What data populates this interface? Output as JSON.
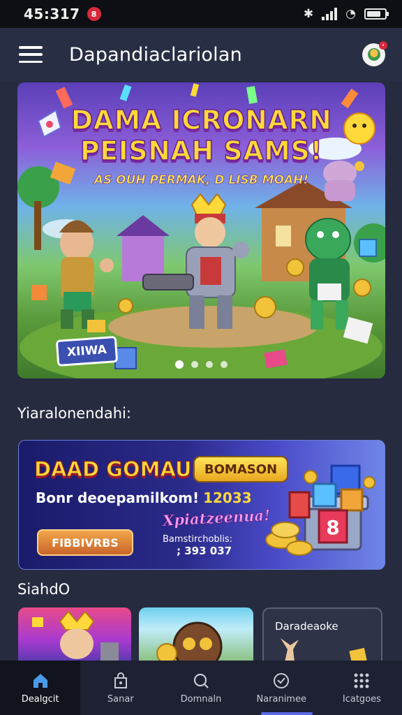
{
  "status_bar": {
    "time": "45:317",
    "notification_count": "8"
  },
  "app_bar": {
    "title": "Dapandiaclariolan"
  },
  "hero": {
    "title_line1": "DAMA ICRONARN",
    "title_line2": "PEISNAH SAMS!",
    "subtitle": "AS OUH PERMAK, D LISB MOAH!",
    "tag": "XIIWA",
    "slide_count": 4,
    "active_slide": 0
  },
  "sections": {
    "featured_title": "Yiaralonendahi:",
    "second_title": "SiahdO"
  },
  "promo": {
    "title": "DAAD GOMAUS",
    "badge": "BOMASON",
    "line_label": "Bonr deoepamilkom!",
    "line_value": "12033",
    "script_text": "Xpiatzeenua!",
    "button": "FIBBIVRBS",
    "meta_label": "Bamstirchoblis:",
    "meta_value": "; 393 037"
  },
  "cards": {
    "third_title": "Daradeaoke"
  },
  "bottom_nav": {
    "items": [
      {
        "label": "Dealgcit",
        "icon": "home-icon"
      },
      {
        "label": "Sanar",
        "icon": "bag-icon"
      },
      {
        "label": "Domnaln",
        "icon": "search-icon"
      },
      {
        "label": "Naranimee",
        "icon": "clock-icon"
      },
      {
        "label": "Icatgoes",
        "icon": "grid-icon"
      }
    ],
    "active_index": 0
  },
  "colors": {
    "background": "#262b3f",
    "accent_yellow": "#ffd93a",
    "nav_active": "#12141d",
    "underline": "#5a6ae8"
  }
}
